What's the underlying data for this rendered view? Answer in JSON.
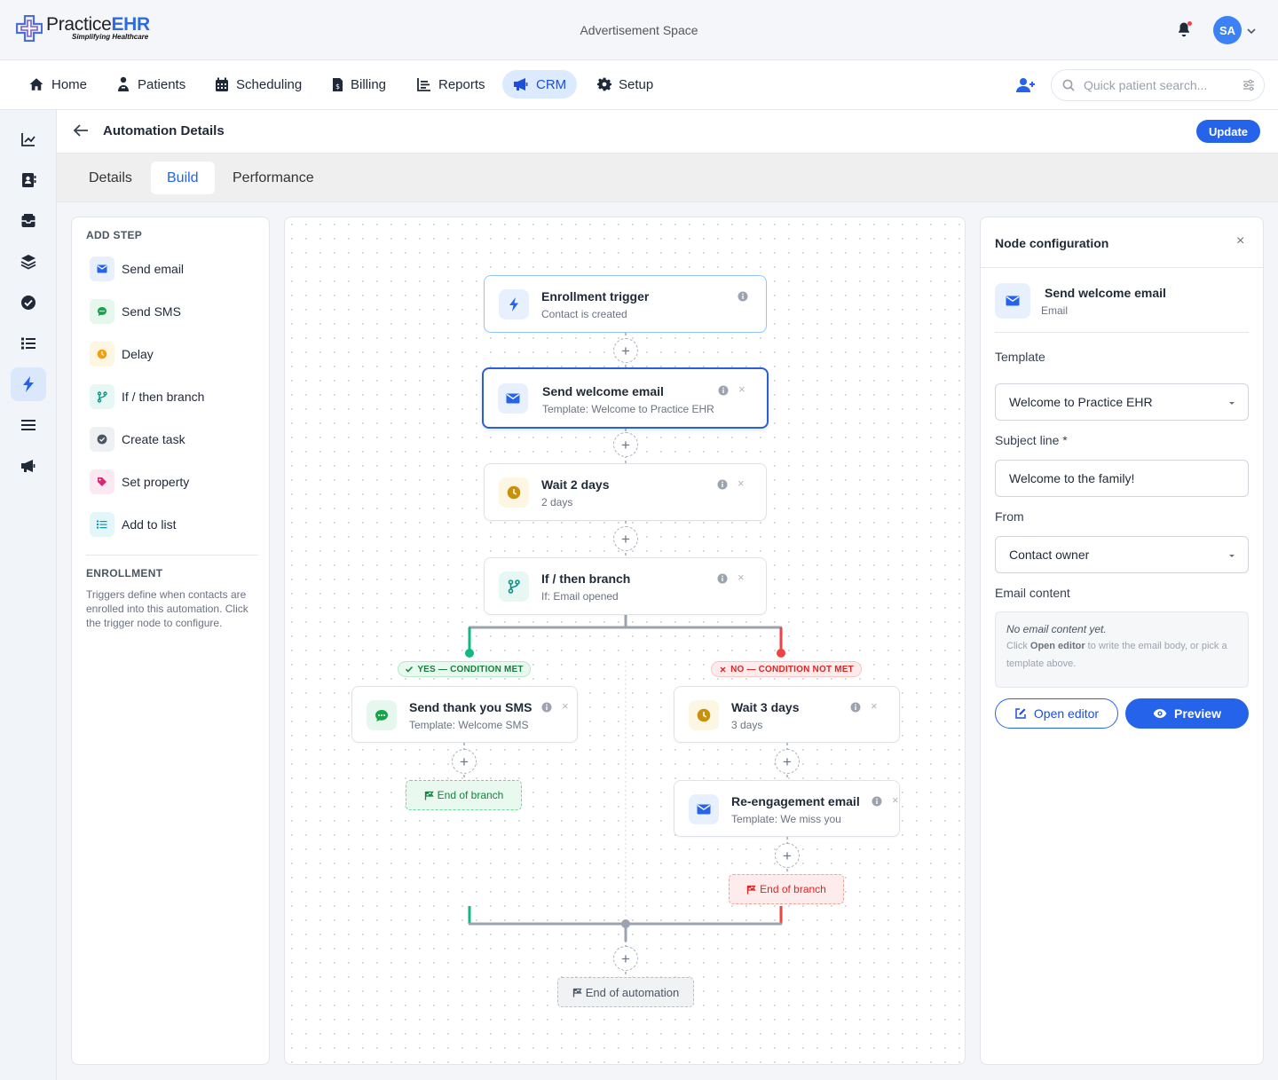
{
  "app": {
    "logo_main": "Practice",
    "logo_accent": "EHR",
    "tagline": "Simplifying Healthcare",
    "ad_text": "Advertisement Space",
    "avatar_initials": "SA",
    "accent_color": "#2563eb"
  },
  "nav": {
    "items": [
      {
        "label": "Home",
        "icon": "home-icon"
      },
      {
        "label": "Patients",
        "icon": "patients-icon"
      },
      {
        "label": "Scheduling",
        "icon": "calendar-icon"
      },
      {
        "label": "Billing",
        "icon": "billing-icon"
      },
      {
        "label": "Reports",
        "icon": "reports-icon"
      },
      {
        "label": "CRM",
        "icon": "megaphone-icon",
        "active": true
      },
      {
        "label": "Setup",
        "icon": "gear-icon"
      }
    ],
    "search_placeholder": "Quick patient search..."
  },
  "rail": {
    "icons": [
      "chart-line-icon",
      "contacts-icon",
      "inbox-icon",
      "layers-icon",
      "check-circle-icon",
      "list-icon",
      "lightning-icon",
      "menu-icon",
      "megaphone-icon"
    ],
    "active_index": 6
  },
  "page": {
    "title": "Automation Details",
    "update_label": "Update",
    "tabs": [
      "Details",
      "Build",
      "Performance"
    ],
    "active_tab": "Build"
  },
  "add_step": {
    "title": "ADD STEP",
    "items": [
      {
        "label": "Send email",
        "icon": "email-icon"
      },
      {
        "label": "Send SMS",
        "icon": "sms-icon"
      },
      {
        "label": "Delay",
        "icon": "clock-icon"
      },
      {
        "label": "If / then branch",
        "icon": "branch-icon"
      },
      {
        "label": "Create task",
        "icon": "task-check-icon"
      },
      {
        "label": "Set property",
        "icon": "tag-icon"
      },
      {
        "label": "Add to list",
        "icon": "list-icon"
      }
    ],
    "enrollment_title": "ENROLLMENT",
    "enrollment_text": "Triggers define when contacts are enrolled into this automation. Click the trigger node to configure."
  },
  "workflow": {
    "trigger": {
      "title": "Enrollment trigger",
      "sub": "Contact is created"
    },
    "welcome": {
      "title": "Send welcome email",
      "sub": "Template: Welcome to Practice EHR"
    },
    "wait2": {
      "title": "Wait 2 days",
      "sub": "2 days"
    },
    "branch": {
      "title": "If / then branch",
      "sub": "If: Email opened"
    },
    "yes_label": "YES — CONDITION MET",
    "no_label": "NO — CONDITION NOT MET",
    "thank_sms": {
      "title": "Send thank you SMS",
      "sub": "Template: Welcome SMS"
    },
    "wait3": {
      "title": "Wait 3 days",
      "sub": "3 days"
    },
    "reengage": {
      "title": "Re-engagement email",
      "sub": "Template: We miss you"
    },
    "end_branch": "End of branch",
    "end_automation": "End of automation",
    "plus": "+",
    "close": "×",
    "yes_color": "#10b981",
    "no_color": "#ef4444"
  },
  "config": {
    "title": "Node configuration",
    "close": "×",
    "node_title": "Send welcome email",
    "node_type": "Email",
    "template_label": "Template",
    "template_value": "Welcome to Practice EHR",
    "subject_label": "Subject line *",
    "subject_value": "Welcome to the family!",
    "from_label": "From",
    "from_value": "Contact owner",
    "content_label": "Email content",
    "content_empty": "No email content yet.",
    "content_help_pre": "Click ",
    "content_help_bold": "Open editor",
    "content_help_post": " to write the email body, or pick a template above.",
    "open_editor": "Open editor",
    "preview": "Preview"
  }
}
